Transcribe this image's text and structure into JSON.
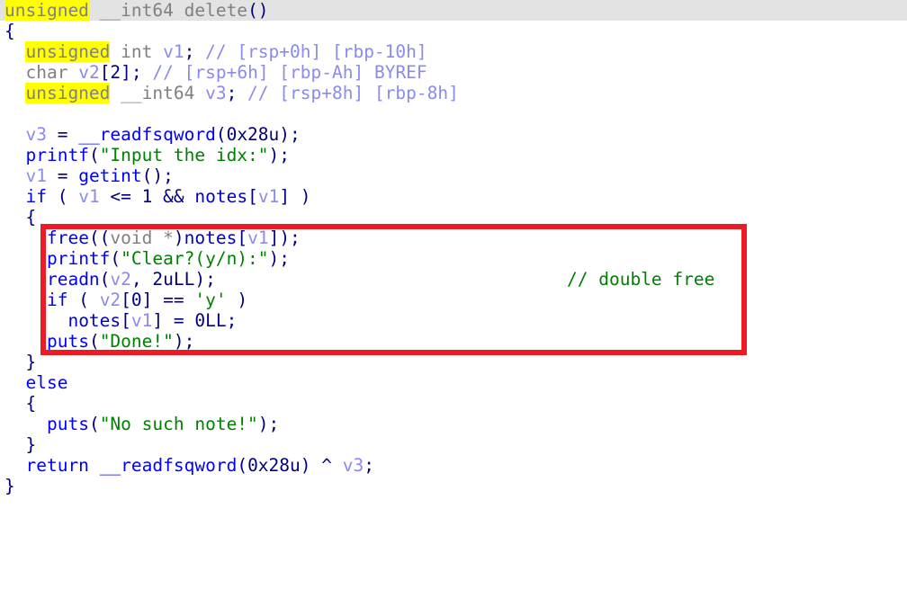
{
  "view": {
    "kind": "hex-rays-pseudocode",
    "background_color": "#ffffff",
    "selected_line_color": "#e3e3e3",
    "highlight_color": "#ffff00",
    "annotation_box_color": "#ed1c24"
  },
  "function": {
    "return_type": "unsigned __int64",
    "name": "delete",
    "signature": "unsigned __int64 delete()"
  },
  "header": {
    "kw_unsigned": "unsigned",
    "space1": " ",
    "type_int64": "__int64",
    "space2": " ",
    "name": "delete",
    "parens": "()"
  },
  "decls": [
    {
      "kw": "unsigned",
      "rest": " int ",
      "var": "v1",
      "semi": ";",
      "slashes": " // ",
      "comment": "[rsp+0h] [rbp-10h]"
    },
    {
      "kw": "char",
      "rest": " ",
      "var": "v2",
      "dims": "[2]",
      "semi": ";",
      "slashes": " // ",
      "comment": "[rsp+6h] [rbp-Ah] BYREF"
    },
    {
      "kw": "unsigned",
      "rest": " __int64 ",
      "var": "v3",
      "semi": ";",
      "slashes": " // ",
      "comment": "[rsp+8h] [rbp-8h]"
    }
  ],
  "body": {
    "open_brace": "{",
    "close_brace": "}",
    "line_v3_assign": {
      "var": "v3",
      "eq": " = ",
      "fn": "__readfsqword",
      "open": "(",
      "arg": "0x28u",
      "close": ");"
    },
    "line_printf_idx": {
      "fn": "printf",
      "open": "(",
      "str": "\"Input the idx:\"",
      "close": ");"
    },
    "line_v1_assign": {
      "var": "v1",
      "eq": " = ",
      "fn": "getint",
      "close": "();"
    },
    "line_if_outer": {
      "kw": "if",
      "open": " ( ",
      "var": "v1",
      "op": " <= ",
      "num": "1",
      "and": " && ",
      "gvar": "notes",
      "idx_open": "[",
      "idx_var": "v1",
      "idx_close": "]",
      "close": " )"
    },
    "line_free": {
      "fn": "free",
      "open": "((",
      "cast": "void *",
      "gvar": "notes",
      "idx_open": "[",
      "idx_var": "v1",
      "idx_close": "]",
      "close": ");"
    },
    "line_printf_clear": {
      "fn": "printf",
      "open": "(",
      "str": "\"Clear?(y/n):\"",
      "close": ");"
    },
    "line_readn": {
      "fn": "readn",
      "open": "(",
      "var": "v2",
      "comma": ", ",
      "num": "2uLL",
      "close": ");"
    },
    "line_if_inner": {
      "kw": "if",
      "open": " ( ",
      "var": "v2",
      "idx": "[0]",
      "op": " == ",
      "chr": "'y'",
      "close": " )"
    },
    "line_notes_zero": {
      "gvar": "notes",
      "idx_open": "[",
      "idx_var": "v1",
      "idx_close": "]",
      "eq": " = ",
      "num": "0LL",
      "semi": ";"
    },
    "line_puts_done": {
      "fn": "puts",
      "open": "(",
      "str": "\"Done!\"",
      "close": ");"
    },
    "line_else": "else",
    "line_puts_nosuch": {
      "fn": "puts",
      "open": "(",
      "str": "\"No such note!\"",
      "close": ");"
    },
    "line_return": {
      "kw": "return",
      "space": " ",
      "fn": "__readfsqword",
      "open": "(",
      "arg": "0x28u",
      "close": ")",
      "xor": " ^ ",
      "var": "v3",
      "semi": ";"
    }
  },
  "annotations": {
    "double_free_comment": "// double free"
  }
}
